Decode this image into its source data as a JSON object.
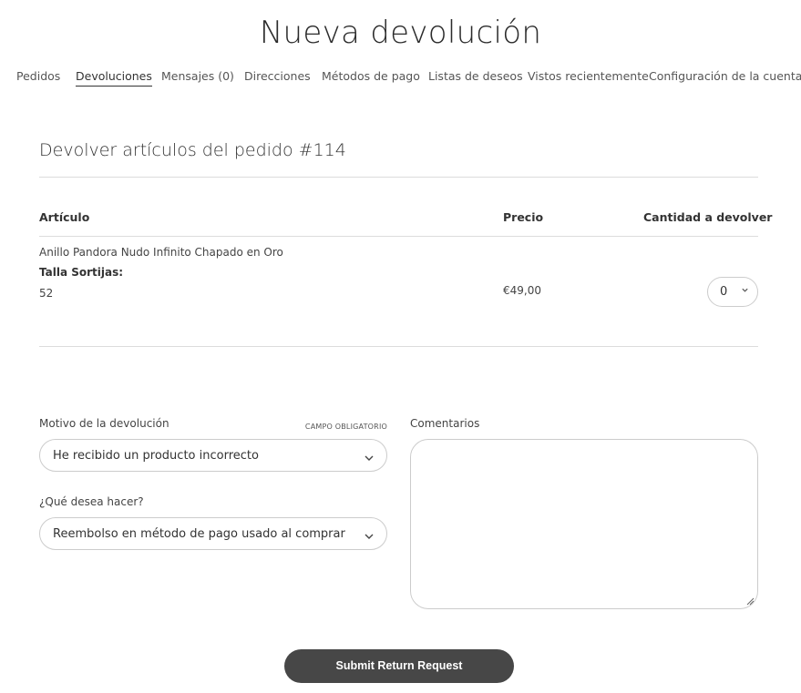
{
  "page": {
    "title": "Nueva devolución"
  },
  "nav": {
    "items": [
      {
        "label": "Pedidos"
      },
      {
        "label": "Devoluciones"
      },
      {
        "label": "Mensajes (0)"
      },
      {
        "label": "Direcciones"
      },
      {
        "label": "Métodos de pago"
      },
      {
        "label": "Listas de deseos"
      },
      {
        "label": "Vistos recientemente"
      },
      {
        "label": "Configuración de la cuenta"
      }
    ],
    "active": "Devoluciones"
  },
  "return": {
    "title": "Devolver artículos del pedido #114",
    "table": {
      "headers": {
        "item": "Artículo",
        "price": "Precio",
        "qty": "Cantidad a devolver"
      },
      "rows": [
        {
          "name": "Anillo Pandora Nudo Infinito Chapado en Oro",
          "attr_label": "Talla Sortijas:",
          "attr_value": "52",
          "price": "€49,00",
          "qty": "0"
        }
      ]
    }
  },
  "form": {
    "reason": {
      "label": "Motivo de la devolución",
      "required": "CAMPO OBLIGATORIO",
      "value": "He recibido un producto incorrecto"
    },
    "action": {
      "label": "¿Qué desea hacer?",
      "value": "Reembolso en método de pago usado al comprar"
    },
    "comments": {
      "label": "Comentarios",
      "value": ""
    },
    "submit": "Submit Return Request"
  }
}
